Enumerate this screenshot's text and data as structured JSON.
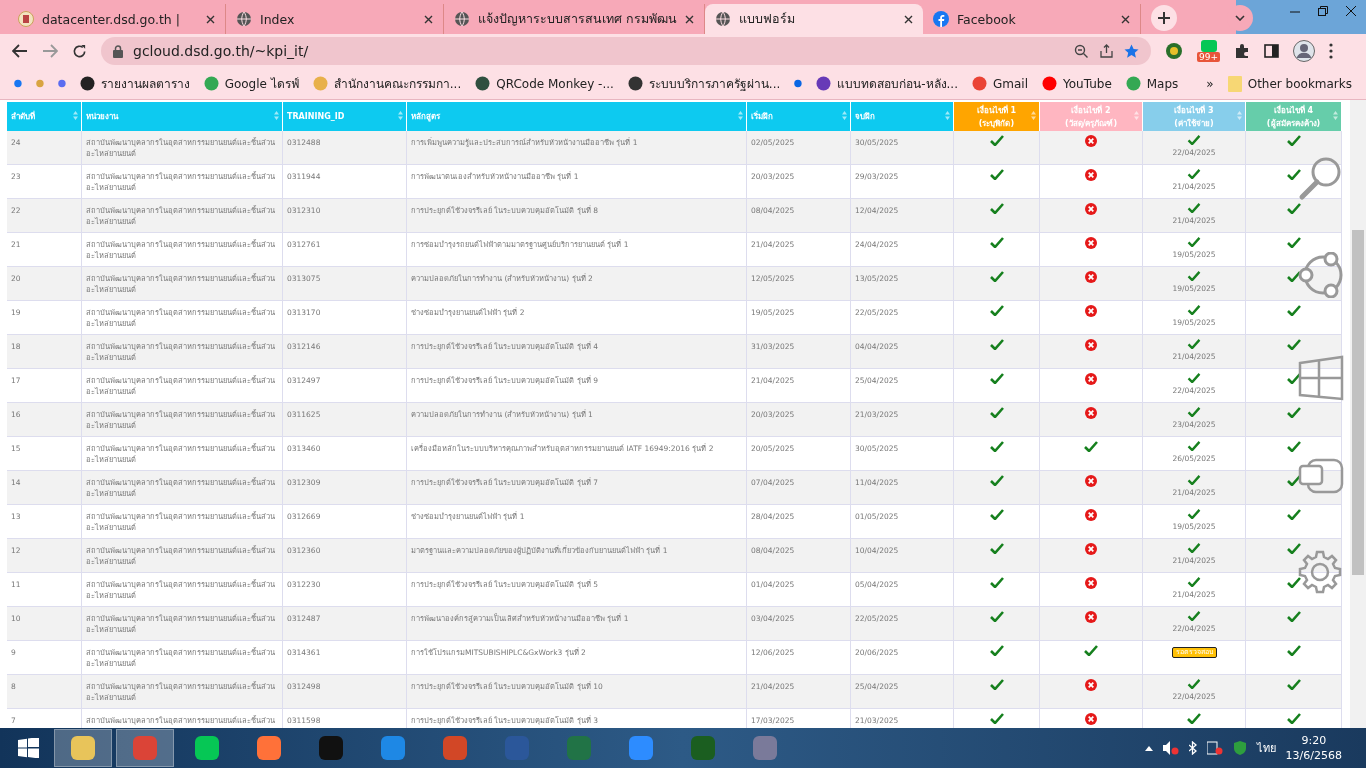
{
  "browser": {
    "tabs": [
      {
        "title": "datacenter.dsd.go.th |",
        "kind": "emblem",
        "selected": false
      },
      {
        "title": "Index",
        "kind": "web",
        "selected": false
      },
      {
        "title": "แจ้งปัญหาระบบสารสนเทศ กรมพัฒน",
        "kind": "web",
        "selected": false
      },
      {
        "title": "แบบฟอร์ม",
        "kind": "web",
        "selected": true
      },
      {
        "title": "Facebook",
        "kind": "social",
        "selected": false
      }
    ],
    "address": "gcloud.dsd.go.th/~kpi_it/",
    "extension_badge": "99+",
    "bookmarks": [
      {
        "color": "#1877f2"
      },
      {
        "color": "#d9a441"
      },
      {
        "color": "#5b6cf0"
      },
      {
        "label": "รายงานผลตาราง",
        "color": "#222222"
      },
      {
        "label": "Google ไดรฟ์",
        "color": "#34a853"
      },
      {
        "label": "สำนักงานคณะกรรมกา...",
        "color": "#e8b04a"
      },
      {
        "label": "QRCode Monkey -...",
        "color": "#2f4f3f"
      },
      {
        "label": "ระบบบริการภาครัฐผ่าน...",
        "color": "#333333"
      },
      {
        "color": "#0a66e4"
      },
      {
        "label": "แบบทดสอบก่อน-หลัง...",
        "color": "#673ab7"
      },
      {
        "label": "Gmail",
        "color": "#ea4335"
      },
      {
        "label": "YouTube",
        "color": "#ff0000"
      },
      {
        "label": "Maps",
        "color": "#34a853"
      }
    ],
    "more": "»",
    "other_bookmarks": "Other bookmarks"
  },
  "table": {
    "columns": [
      {
        "label": "ลำดับที่",
        "color": "#0dcaf0"
      },
      {
        "label": "หน่วยงาน",
        "color": "#0dcaf0"
      },
      {
        "label": "TRAINING_ID",
        "color": "#0dcaf0"
      },
      {
        "label": "หลักสูตร",
        "color": "#0dcaf0"
      },
      {
        "label": "เริ่มฝึก",
        "color": "#0dcaf0"
      },
      {
        "label": "จบฝึก",
        "color": "#0dcaf0"
      },
      {
        "label": "เงื่อนไขที่ 1",
        "sub": "(ระบุพิกัด)",
        "color": "#ffa500"
      },
      {
        "label": "เงื่อนไขที่ 2",
        "sub": "(วัสดุ/ครุภัณฑ์)",
        "color": "#ffb6c1"
      },
      {
        "label": "เงื่อนไขที่ 3",
        "sub": "(ค่าใช้จ่าย)",
        "color": "#87ceeb"
      },
      {
        "label": "เงื่อนไขที่ 4",
        "sub": "(ผู้สมัครคงค้าง)",
        "color": "#66cdaa"
      }
    ],
    "rows": [
      {
        "no": "24",
        "agency": "สถาบันพัฒนาบุคลากรในอุตสาหกรรมยานยนต์และชิ้นส่วนอะไหล่ยานยนต์",
        "id": "0312488",
        "course": "การเพิ่มพูนความรู้และประสบการณ์สำหรับหัวหน้างานมืออาชีพ รุ่นที่ 1",
        "start": "02/05/2025",
        "end": "30/05/2025",
        "c1": true,
        "c2": false,
        "c3": {
          "kind": "check",
          "date": "22/04/2025"
        },
        "c4": true
      },
      {
        "no": "23",
        "agency": "สถาบันพัฒนาบุคลากรในอุตสาหกรรมยานยนต์และชิ้นส่วนอะไหล่ยานยนต์",
        "id": "0311944",
        "course": "การพัฒนาตนเองสำหรับหัวหน้างานมืออาชีพ รุ่นที่ 1",
        "start": "20/03/2025",
        "end": "29/03/2025",
        "c1": true,
        "c2": false,
        "c3": {
          "kind": "check",
          "date": "21/04/2025"
        },
        "c4": true
      },
      {
        "no": "22",
        "agency": "สถาบันพัฒนาบุคลากรในอุตสาหกรรมยานยนต์และชิ้นส่วนอะไหล่ยานยนต์",
        "id": "0312310",
        "course": "การประยุกต์ใช้วงจรรีเลย์ ในระบบควบคุมอัตโนมัติ รุ่นที่ 8",
        "start": "08/04/2025",
        "end": "12/04/2025",
        "c1": true,
        "c2": false,
        "c3": {
          "kind": "check",
          "date": "21/04/2025"
        },
        "c4": true
      },
      {
        "no": "21",
        "agency": "สถาบันพัฒนาบุคลากรในอุตสาหกรรมยานยนต์และชิ้นส่วนอะไหล่ยานยนต์",
        "id": "0312761",
        "course": "การซ่อมบำรุงรถยนต์ไฟฟ้าตามมาตรฐานศูนย์บริการยานยนต์ รุ่นที่ 1",
        "start": "21/04/2025",
        "end": "24/04/2025",
        "c1": true,
        "c2": false,
        "c3": {
          "kind": "check",
          "date": "19/05/2025"
        },
        "c4": true
      },
      {
        "no": "20",
        "agency": "สถาบันพัฒนาบุคลากรในอุตสาหกรรมยานยนต์และชิ้นส่วนอะไหล่ยานยนต์",
        "id": "0313075",
        "course": "ความปลอดภัยในการทำงาน (สำหรับหัวหน้างาน) รุ่นที่ 2",
        "start": "12/05/2025",
        "end": "13/05/2025",
        "c1": true,
        "c2": false,
        "c3": {
          "kind": "check",
          "date": "19/05/2025"
        },
        "c4": true
      },
      {
        "no": "19",
        "agency": "สถาบันพัฒนาบุคลากรในอุตสาหกรรมยานยนต์และชิ้นส่วนอะไหล่ยานยนต์",
        "id": "0313170",
        "course": "ช่างซ่อมบำรุงยานยนต์ไฟฟ้า รุ่นที่ 2",
        "start": "19/05/2025",
        "end": "22/05/2025",
        "c1": true,
        "c2": false,
        "c3": {
          "kind": "check",
          "date": "19/05/2025"
        },
        "c4": true
      },
      {
        "no": "18",
        "agency": "สถาบันพัฒนาบุคลากรในอุตสาหกรรมยานยนต์และชิ้นส่วนอะไหล่ยานยนต์",
        "id": "0312146",
        "course": "การประยุกต์ใช้วงจรรีเลย์ ในระบบควบคุมอัตโนมัติ รุ่นที่ 4",
        "start": "31/03/2025",
        "end": "04/04/2025",
        "c1": true,
        "c2": false,
        "c3": {
          "kind": "check",
          "date": "21/04/2025"
        },
        "c4": true
      },
      {
        "no": "17",
        "agency": "สถาบันพัฒนาบุคลากรในอุตสาหกรรมยานยนต์และชิ้นส่วนอะไหล่ยานยนต์",
        "id": "0312497",
        "course": "การประยุกต์ใช้วงจรรีเลย์ ในระบบควบคุมอัตโนมัติ รุ่นที่ 9",
        "start": "21/04/2025",
        "end": "25/04/2025",
        "c1": true,
        "c2": false,
        "c3": {
          "kind": "check",
          "date": "22/04/2025"
        },
        "c4": true
      },
      {
        "no": "16",
        "agency": "สถาบันพัฒนาบุคลากรในอุตสาหกรรมยานยนต์และชิ้นส่วนอะไหล่ยานยนต์",
        "id": "0311625",
        "course": "ความปลอดภัยในการทำงาน (สำหรับหัวหน้างาน) รุ่นที่ 1",
        "start": "20/03/2025",
        "end": "21/03/2025",
        "c1": true,
        "c2": false,
        "c3": {
          "kind": "check",
          "date": "23/04/2025"
        },
        "c4": true
      },
      {
        "no": "15",
        "agency": "สถาบันพัฒนาบุคลากรในอุตสาหกรรมยานยนต์และชิ้นส่วนอะไหล่ยานยนต์",
        "id": "0313460",
        "course": "เครื่องมือหลักในระบบบริหารคุณภาพสำหรับอุตสาหกรรมยานยนต์ IATF 16949:2016 รุ่นที่ 2",
        "start": "20/05/2025",
        "end": "30/05/2025",
        "c1": true,
        "c2": true,
        "c3": {
          "kind": "check",
          "date": "26/05/2025"
        },
        "c4": true
      },
      {
        "no": "14",
        "agency": "สถาบันพัฒนาบุคลากรในอุตสาหกรรมยานยนต์และชิ้นส่วนอะไหล่ยานยนต์",
        "id": "0312309",
        "course": "การประยุกต์ใช้วงจรรีเลย์ ในระบบควบคุมอัตโนมัติ รุ่นที่ 7",
        "start": "07/04/2025",
        "end": "11/04/2025",
        "c1": true,
        "c2": false,
        "c3": {
          "kind": "check",
          "date": "21/04/2025"
        },
        "c4": true
      },
      {
        "no": "13",
        "agency": "สถาบันพัฒนาบุคลากรในอุตสาหกรรมยานยนต์และชิ้นส่วนอะไหล่ยานยนต์",
        "id": "0312669",
        "course": "ช่างซ่อมบำรุงยานยนต์ไฟฟ้า รุ่นที่ 1",
        "start": "28/04/2025",
        "end": "01/05/2025",
        "c1": true,
        "c2": false,
        "c3": {
          "kind": "check",
          "date": "19/05/2025"
        },
        "c4": true
      },
      {
        "no": "12",
        "agency": "สถาบันพัฒนาบุคลากรในอุตสาหกรรมยานยนต์และชิ้นส่วนอะไหล่ยานยนต์",
        "id": "0312360",
        "course": "มาตรฐานและความปลอดภัยของผู้ปฏิบัติงานที่เกี่ยวข้องกับยานยนต์ไฟฟ้า รุ่นที่ 1",
        "start": "08/04/2025",
        "end": "10/04/2025",
        "c1": true,
        "c2": false,
        "c3": {
          "kind": "check",
          "date": "21/04/2025"
        },
        "c4": true
      },
      {
        "no": "11",
        "agency": "สถาบันพัฒนาบุคลากรในอุตสาหกรรมยานยนต์และชิ้นส่วนอะไหล่ยานยนต์",
        "id": "0312230",
        "course": "การประยุกต์ใช้วงจรรีเลย์ ในระบบควบคุมอัตโนมัติ รุ่นที่ 5",
        "start": "01/04/2025",
        "end": "05/04/2025",
        "c1": true,
        "c2": false,
        "c3": {
          "kind": "check",
          "date": "21/04/2025"
        },
        "c4": true
      },
      {
        "no": "10",
        "agency": "สถาบันพัฒนาบุคลากรในอุตสาหกรรมยานยนต์และชิ้นส่วนอะไหล่ยานยนต์",
        "id": "0312487",
        "course": "การพัฒนาองค์กรสู่ความเป็นเลิศสำหรับหัวหน้างานมืออาชีพ รุ่นที่ 1",
        "start": "03/04/2025",
        "end": "22/05/2025",
        "c1": true,
        "c2": false,
        "c3": {
          "kind": "check",
          "date": "22/04/2025"
        },
        "c4": true
      },
      {
        "no": "9",
        "agency": "สถาบันพัฒนาบุคลากรในอุตสาหกรรมยานยนต์และชิ้นส่วนอะไหล่ยานยนต์",
        "id": "0314361",
        "course": "การใช้โปรแกรมMITSUBISHIPLC&GxWork3 รุ่นที่ 2",
        "start": "12/06/2025",
        "end": "20/06/2025",
        "c1": true,
        "c2": true,
        "c3": {
          "kind": "badge",
          "label": "รอตรวจสอบ"
        },
        "c4": true
      },
      {
        "no": "8",
        "agency": "สถาบันพัฒนาบุคลากรในอุตสาหกรรมยานยนต์และชิ้นส่วนอะไหล่ยานยนต์",
        "id": "0312498",
        "course": "การประยุกต์ใช้วงจรรีเลย์ ในระบบควบคุมอัตโนมัติ รุ่นที่ 10",
        "start": "21/04/2025",
        "end": "25/04/2025",
        "c1": true,
        "c2": false,
        "c3": {
          "kind": "check",
          "date": "22/04/2025"
        },
        "c4": true
      },
      {
        "no": "7",
        "agency": "สถาบันพัฒนาบุคลากรในอุตสาหกรรมยานยนต์และชิ้นส่วน",
        "id": "0311598",
        "course": "การประยุกต์ใช้วงจรรีเลย์ ในระบบควบคุมอัตโนมัติ รุ่นที่ 3",
        "start": "17/03/2025",
        "end": "21/03/2025",
        "c1": true,
        "c2": false,
        "c3": {
          "kind": "check"
        },
        "c4": true
      }
    ]
  },
  "taskbar": {
    "apps": [
      {
        "color": "#e8c45a",
        "selected": true
      },
      {
        "color": "#db4437",
        "selected": true
      },
      {
        "color": "#06c755",
        "selected": false
      },
      {
        "color": "#ff7139",
        "selected": false
      },
      {
        "color": "#111111",
        "selected": false
      },
      {
        "color": "#1e88e5",
        "selected": false
      },
      {
        "color": "#d24726",
        "selected": false
      },
      {
        "color": "#2b579a",
        "selected": false
      },
      {
        "color": "#217346",
        "selected": false
      },
      {
        "color": "#2d8cff",
        "selected": false
      },
      {
        "color": "#1b5e20",
        "selected": false
      },
      {
        "color": "#7a7a9a",
        "selected": false
      }
    ],
    "language": "ไทย",
    "time": "9:20",
    "date": "13/6/2568"
  }
}
